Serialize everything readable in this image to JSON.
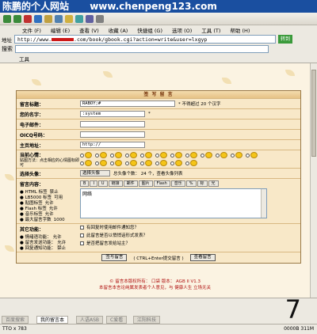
{
  "watermark": {
    "site": "陈鹏的个人网站",
    "url": "www.chenpeng123.com"
  },
  "menu": [
    "文件 (F)",
    "编辑 (E)",
    "查看 (V)",
    "收藏 (A)",
    "快捷组 (G)",
    "选项 (O)",
    "工具 (T)",
    "帮助 (H)"
  ],
  "address": {
    "label": "地址",
    "prefix": "http://www.",
    "suffix": ".com/book/gbook.cgi?action=write&user=lxgyp",
    "go": "转到"
  },
  "search": {
    "label": "搜索"
  },
  "tools": {
    "label": "工具"
  },
  "form": {
    "title": "签 写 留 言",
    "subject_label": "留言标题：",
    "subject_value": "RABOY;#",
    "subject_hint": "* 不得超过 20 个汉字",
    "name_label": "您的名字：",
    "name_value": ":system",
    "name_star": "*",
    "email_label": "电子邮件：",
    "oicq_label": "OICQ号码：",
    "homepage_label": "主页地址：",
    "homepage_value": "http://",
    "mood_label": "当前心情：",
    "mood_hint": "贴图方法：点击相应的心情图标即可",
    "avatar_label": "选择头像：",
    "avatar_select": "选择头像",
    "avatar_info": "总头像个数： 24 个，查看头像列表",
    "content_label": "留言内容：",
    "ubb_buttons": [
      "B",
      "I",
      "U",
      "链接",
      "邮件",
      "图片",
      "Flash",
      "音乐",
      "%",
      "标",
      "光"
    ],
    "content_value": "网络",
    "rules": [
      {
        "name": "HTML 标签",
        "state": "禁止"
      },
      {
        "name": "LB5000 标签",
        "state": "可用"
      },
      {
        "name": "贴图标签",
        "state": "允许"
      },
      {
        "name": "Flash 标签",
        "state": "允许"
      },
      {
        "name": "音乐标签",
        "state": "允许"
      },
      {
        "name": "最大留言字数",
        "state": "1000"
      }
    ],
    "other_label": "其它功能：",
    "features": [
      {
        "name": "情绪语功能",
        "state": "允许"
      },
      {
        "name": "留言发送功能",
        "state": "允许"
      },
      {
        "name": "回复通知功能",
        "state": "禁止"
      }
    ],
    "options": [
      "有回复时使用邮件通知您？",
      "此留言是否以悄悄话形式发表？",
      "是否把留言发给站主？"
    ],
    "submit": "签写留言",
    "submit_hint": "( CTRL+Enter提交留言 )",
    "view": "查看留言"
  },
  "footer": {
    "line1": "© 留言本版权所有： 口袋   版本： AGB II V1.3",
    "line2": "本留言本言论纯属发表者个人意见，与 健康人生 立场无关"
  },
  "tabs": [
    "百度搜索",
    "我的留言本",
    "人语ASB",
    "C爱看",
    "江阳科技"
  ],
  "status": {
    "left": "TTO x 783",
    "right": "0000B  311M"
  },
  "overlay_number": "7"
}
